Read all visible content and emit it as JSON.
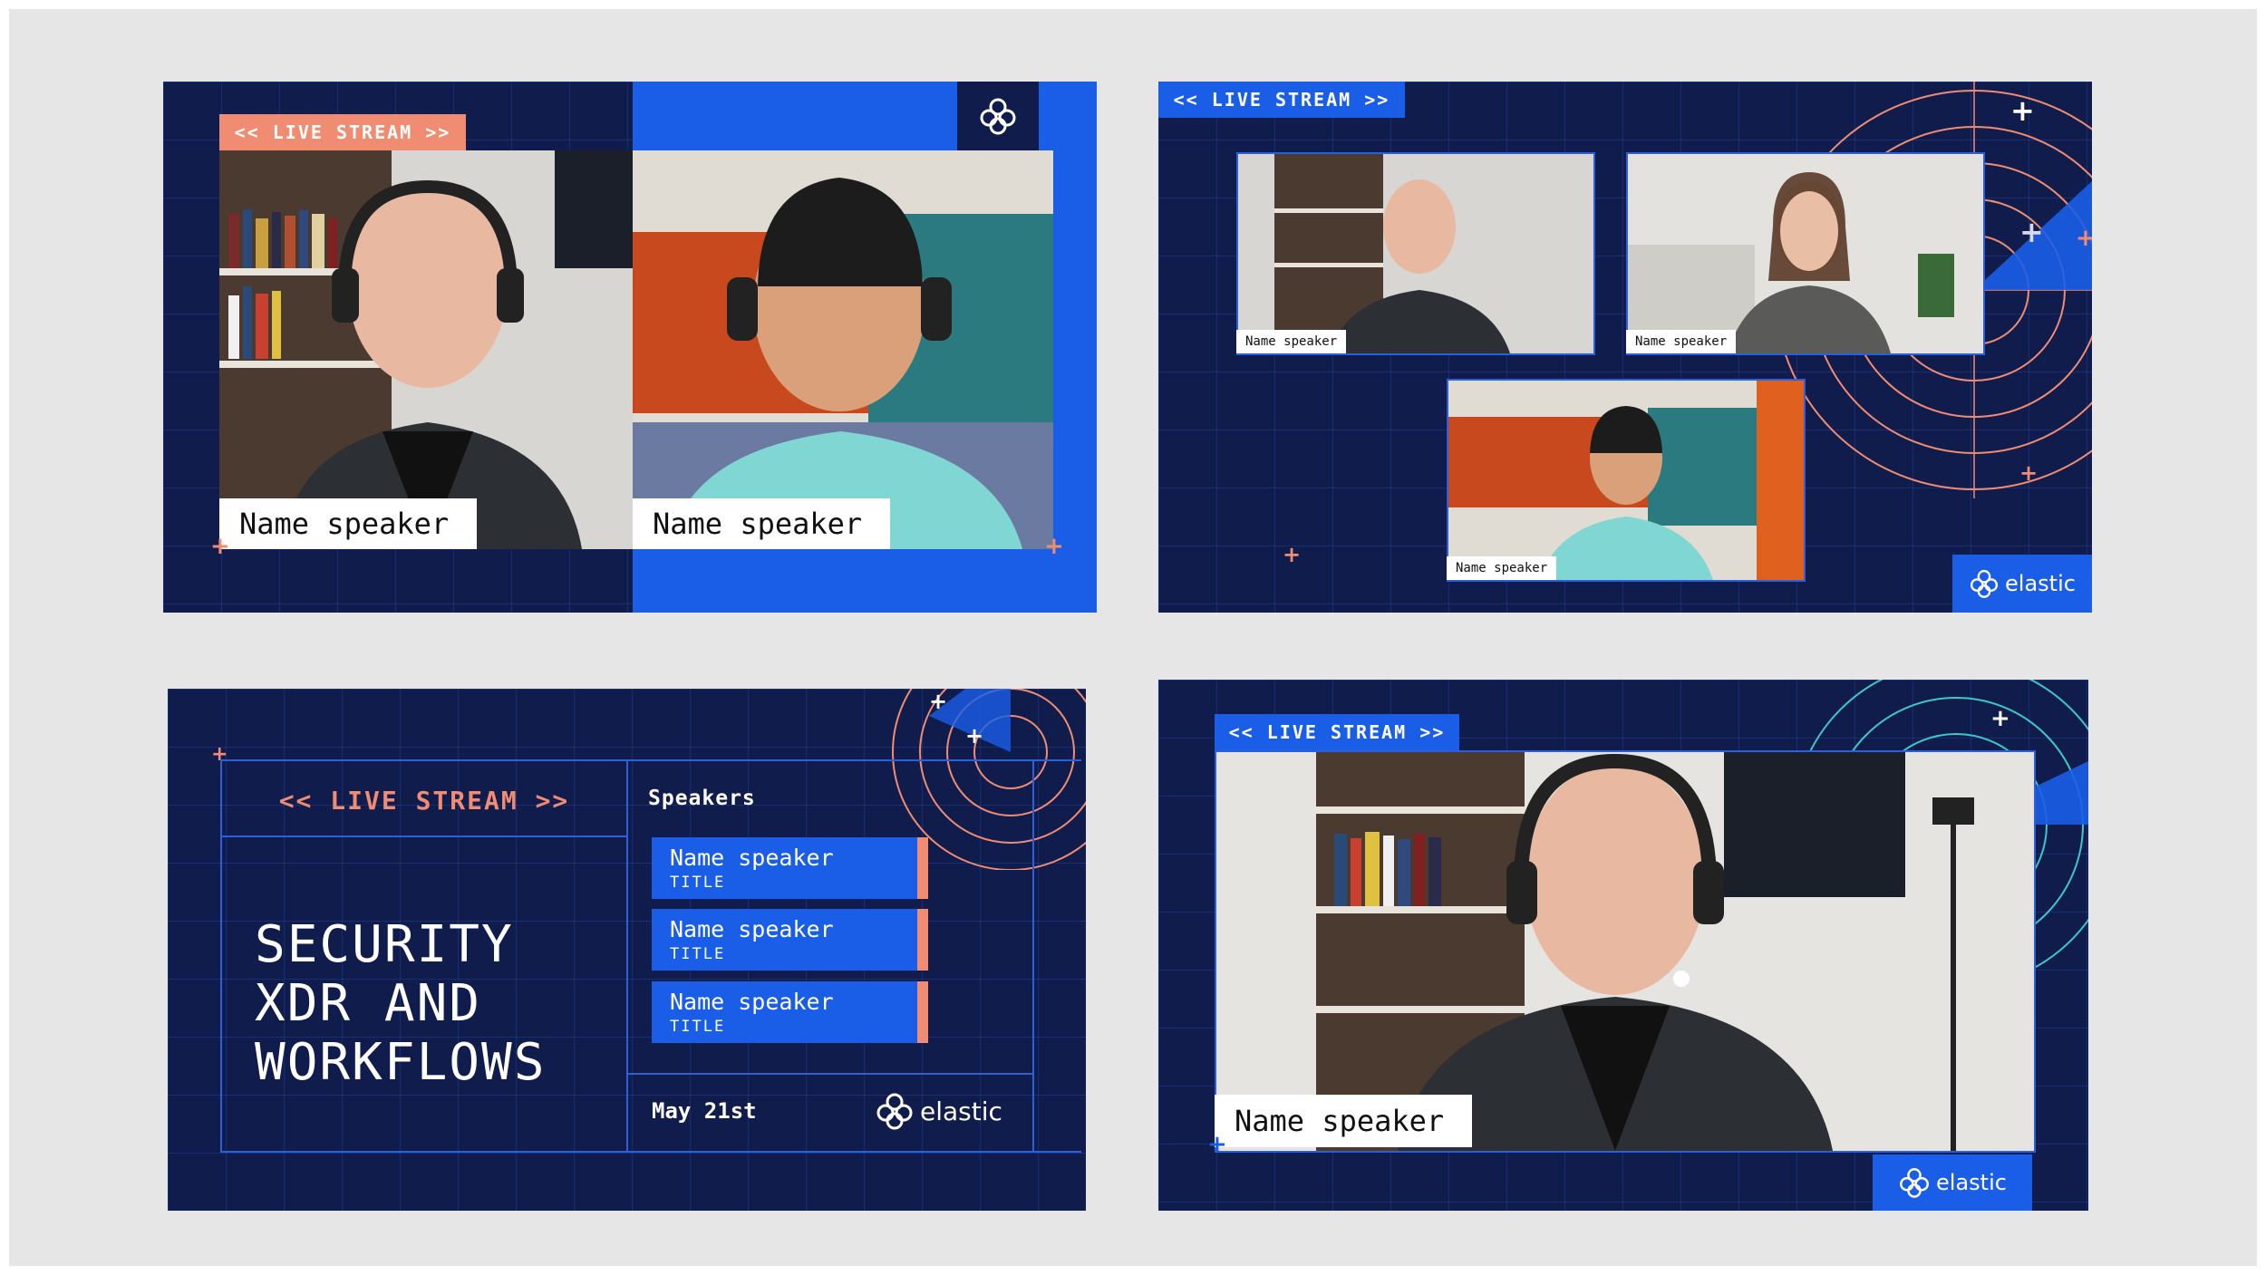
{
  "tag_text": "<< LIVE STREAM >>",
  "name_label": "Name speaker",
  "brand": {
    "logo_icon": "elastic-logo-icon",
    "wordmark": "elastic"
  },
  "colors": {
    "navy": "#101c4c",
    "blue": "#1a5ee8",
    "coral": "#f08c72",
    "teal": "#3fc7c7",
    "white": "#ffffff"
  },
  "cards": {
    "two_speaker": {
      "tag": "<< LIVE STREAM >>",
      "speakers": [
        "Name speaker",
        "Name speaker"
      ]
    },
    "three_speaker": {
      "tag": "<< LIVE STREAM >>",
      "speakers": [
        "Name speaker",
        "Name speaker",
        "Name speaker"
      ],
      "brand": "elastic"
    },
    "agenda": {
      "tag": "<< LIVE STREAM >>",
      "title_lines": [
        "SECURITY",
        "XDR AND",
        "WORKFLOWS"
      ],
      "speakers_heading": "Speakers",
      "speaker_list": [
        {
          "name": "Name speaker",
          "title": "TITLE"
        },
        {
          "name": "Name speaker",
          "title": "TITLE"
        },
        {
          "name": "Name speaker",
          "title": "TITLE"
        }
      ],
      "date": "May 21st",
      "brand": "elastic"
    },
    "single_speaker": {
      "tag": "<< LIVE STREAM >>",
      "speaker": "Name speaker",
      "brand": "elastic"
    }
  }
}
